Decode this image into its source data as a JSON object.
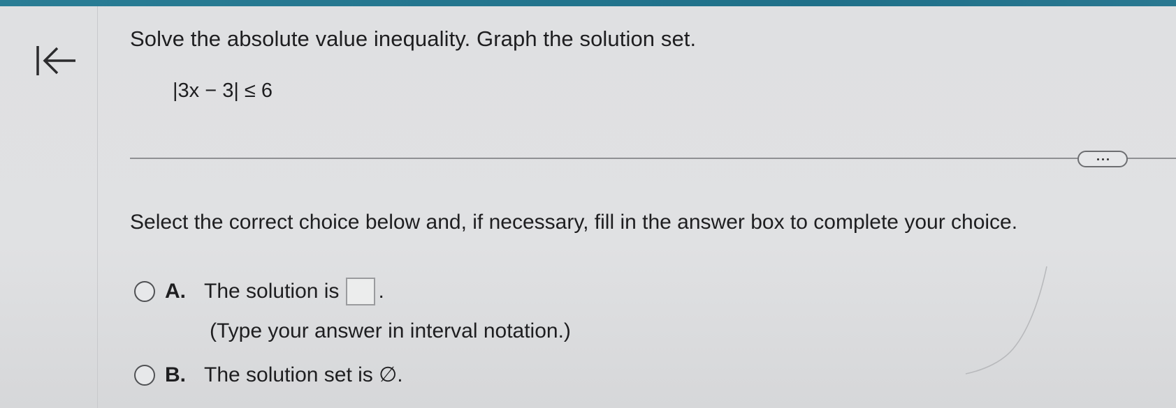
{
  "question": {
    "title": "Solve the absolute value inequality. Graph the solution set.",
    "inequality": "|3x − 3| ≤ 6"
  },
  "toolbar": {
    "back_icon": "back-to-start-icon",
    "more_button": "more-options"
  },
  "instruction": "Select the correct choice below and, if necessary, fill in the answer box to complete your choice.",
  "choices": [
    {
      "letter": "A.",
      "text_before": "The solution is",
      "text_after": ".",
      "hint": "(Type your answer in interval notation.)",
      "answer_value": ""
    },
    {
      "letter": "B.",
      "text": "The solution set is ∅."
    }
  ],
  "colors": {
    "top_bar": "#1f7089",
    "background": "#e0e1e3",
    "text": "#1e1e20"
  }
}
